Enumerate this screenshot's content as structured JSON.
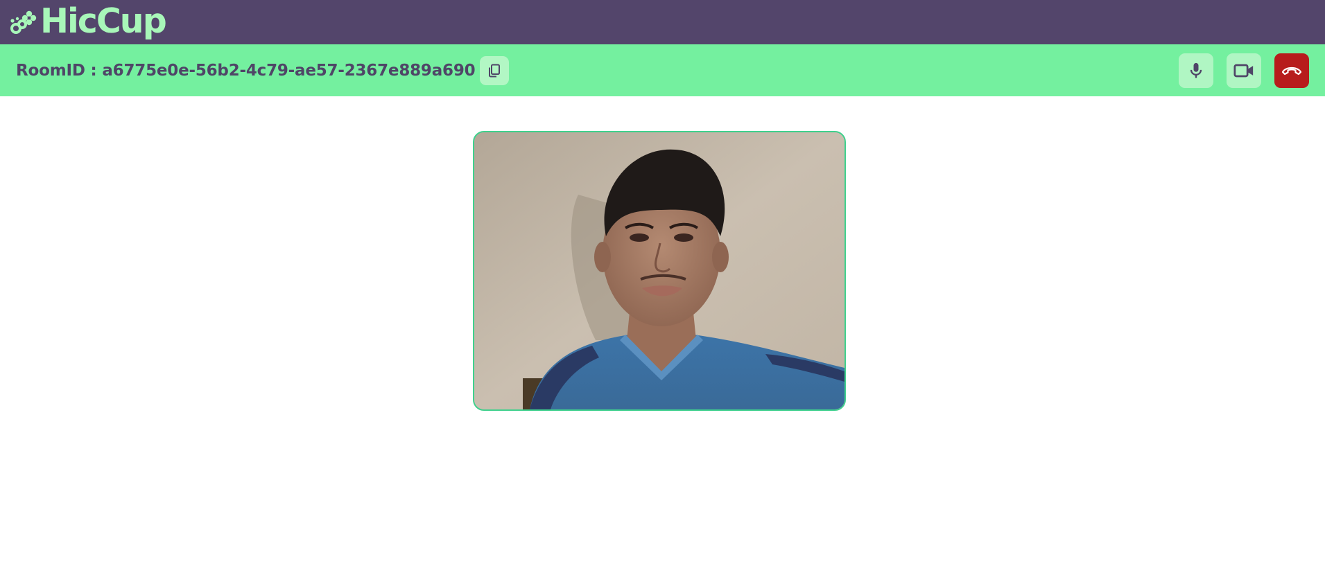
{
  "app": {
    "name": "HicCup",
    "colors": {
      "header_bg": "#53456b",
      "logo": "#a8f7b9",
      "room_bar_bg": "#74f09f",
      "room_text": "#4f4567",
      "button_bg": "#b0f6c3",
      "end_call_bg": "#b71c1c",
      "video_border": "#3fd18d"
    }
  },
  "header": {
    "logo_text": "HicCup",
    "logo_icon": "logo-icon"
  },
  "room_bar": {
    "room_id_label": "RoomID : a6775e0e-56b2-4c79-ae57-2367e889a690",
    "copy_icon": "copy-icon"
  },
  "controls": {
    "microphone_icon": "microphone-icon",
    "camera_icon": "video-camera-icon",
    "end_call_icon": "phone-hangup-icon"
  },
  "video": {
    "feed": "local-video-feed"
  }
}
